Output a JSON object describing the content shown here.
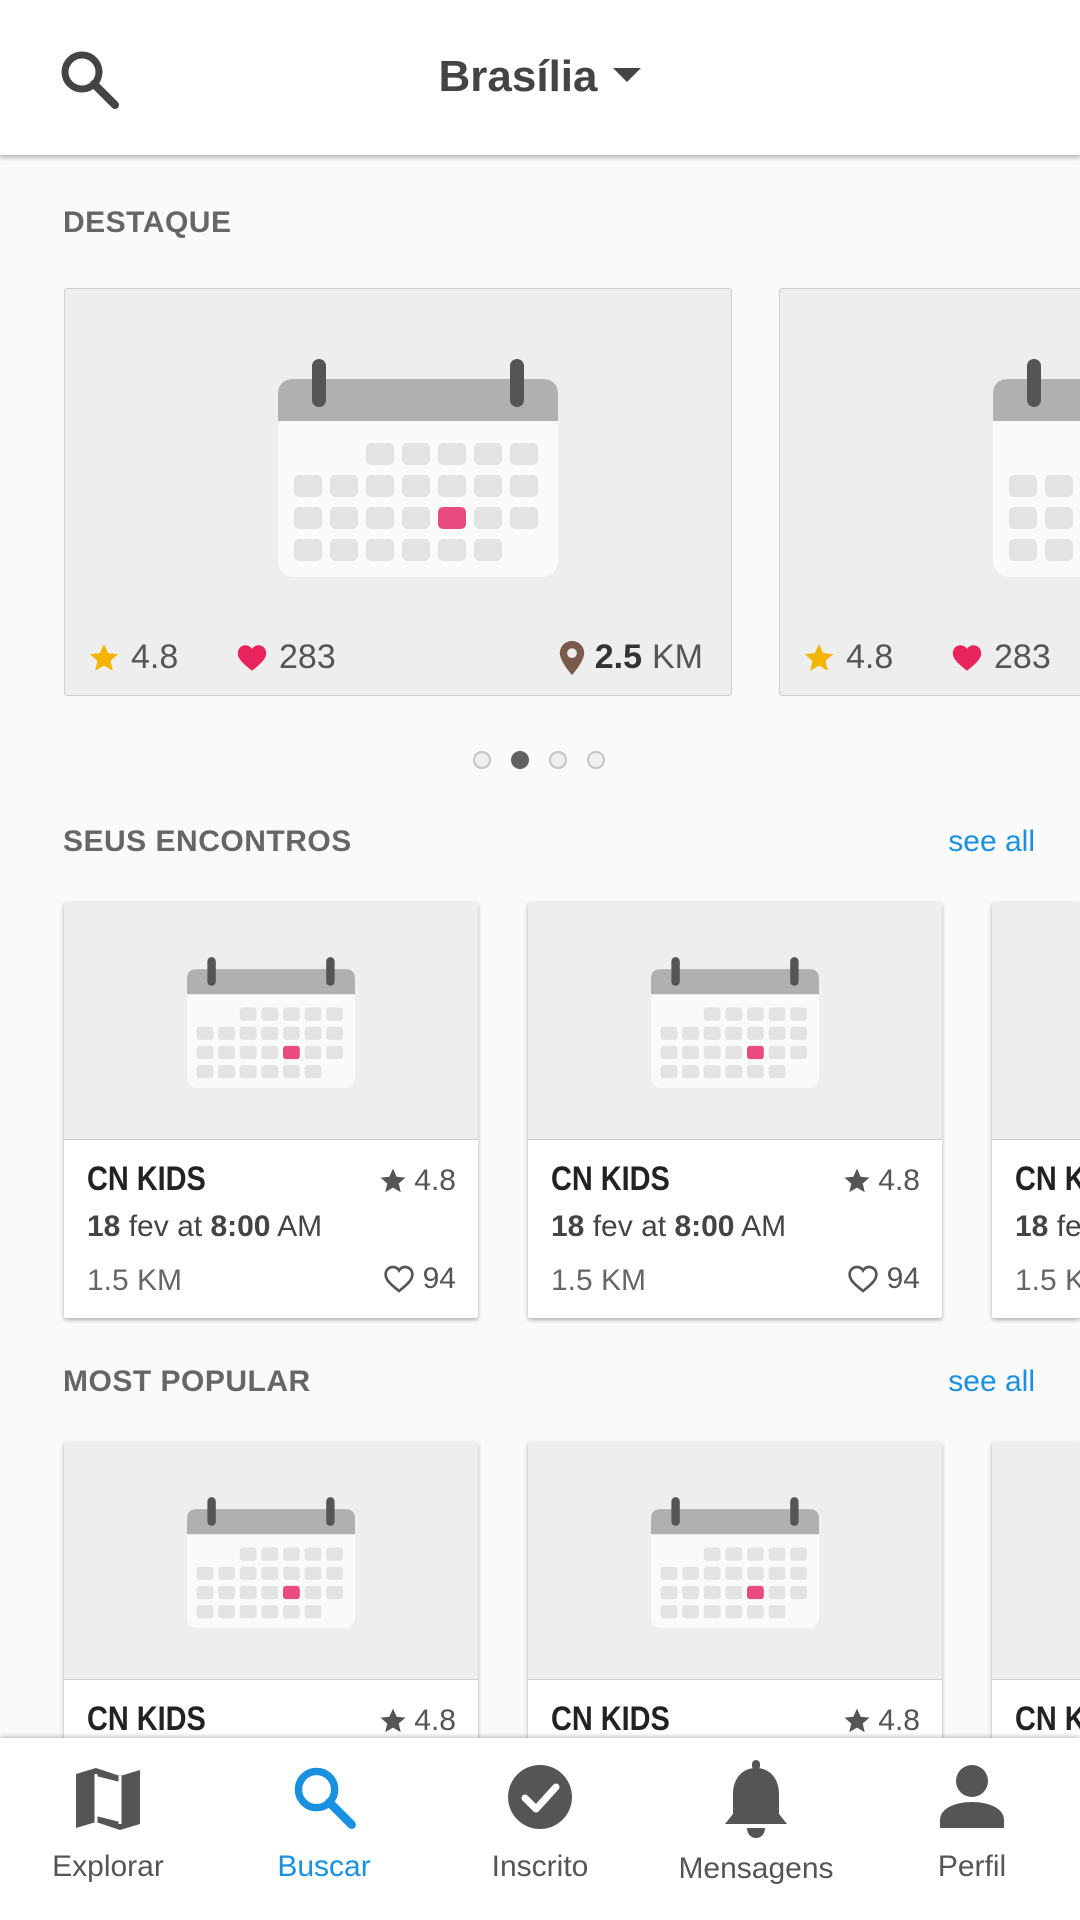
{
  "header": {
    "city": "Brasília"
  },
  "featured": {
    "title": "DESTAQUE",
    "cards": [
      {
        "rating": "4.8",
        "likes": "283",
        "distance_value": "2.5",
        "distance_unit": "KM"
      },
      {
        "rating": "4.8",
        "likes": "283"
      }
    ],
    "pager": {
      "pages": 4,
      "active_index": 1
    }
  },
  "encounters": {
    "title": "SEUS ENCONTROS",
    "see_all": "see all",
    "cards": [
      {
        "name": "CN KIDS",
        "rating": "4.8",
        "date_day": "18",
        "date_mid": "fev at",
        "date_time": "8:00",
        "date_ampm": "AM",
        "distance": "1.5 KM",
        "likes": "94"
      },
      {
        "name": "CN KIDS",
        "rating": "4.8",
        "date_day": "18",
        "date_mid": "fev at",
        "date_time": "8:00",
        "date_ampm": "AM",
        "distance": "1.5 KM",
        "likes": "94"
      },
      {
        "name": "CN K",
        "date_day": "18",
        "date_mid": "fe",
        "distance": "1.5 K"
      }
    ]
  },
  "popular": {
    "title": "MOST POPULAR",
    "see_all": "see all",
    "cards": [
      {
        "name": "CN KIDS",
        "rating": "4.8"
      },
      {
        "name": "CN KIDS",
        "rating": "4.8"
      },
      {
        "name": "CN K"
      }
    ]
  },
  "bottom_nav": [
    {
      "label": "Explorar",
      "icon": "map-icon"
    },
    {
      "label": "Buscar",
      "icon": "search-icon",
      "active": true
    },
    {
      "label": "Inscrito",
      "icon": "check-circle-icon"
    },
    {
      "label": "Mensagens",
      "icon": "bell-icon"
    },
    {
      "label": "Perfil",
      "icon": "person-icon"
    }
  ],
  "colors": {
    "accent": "#1a90e0",
    "star": "#f5b400",
    "heart": "#e8245e",
    "calendar_highlight": "#e94a7f",
    "pin": "#7a5a4a"
  }
}
